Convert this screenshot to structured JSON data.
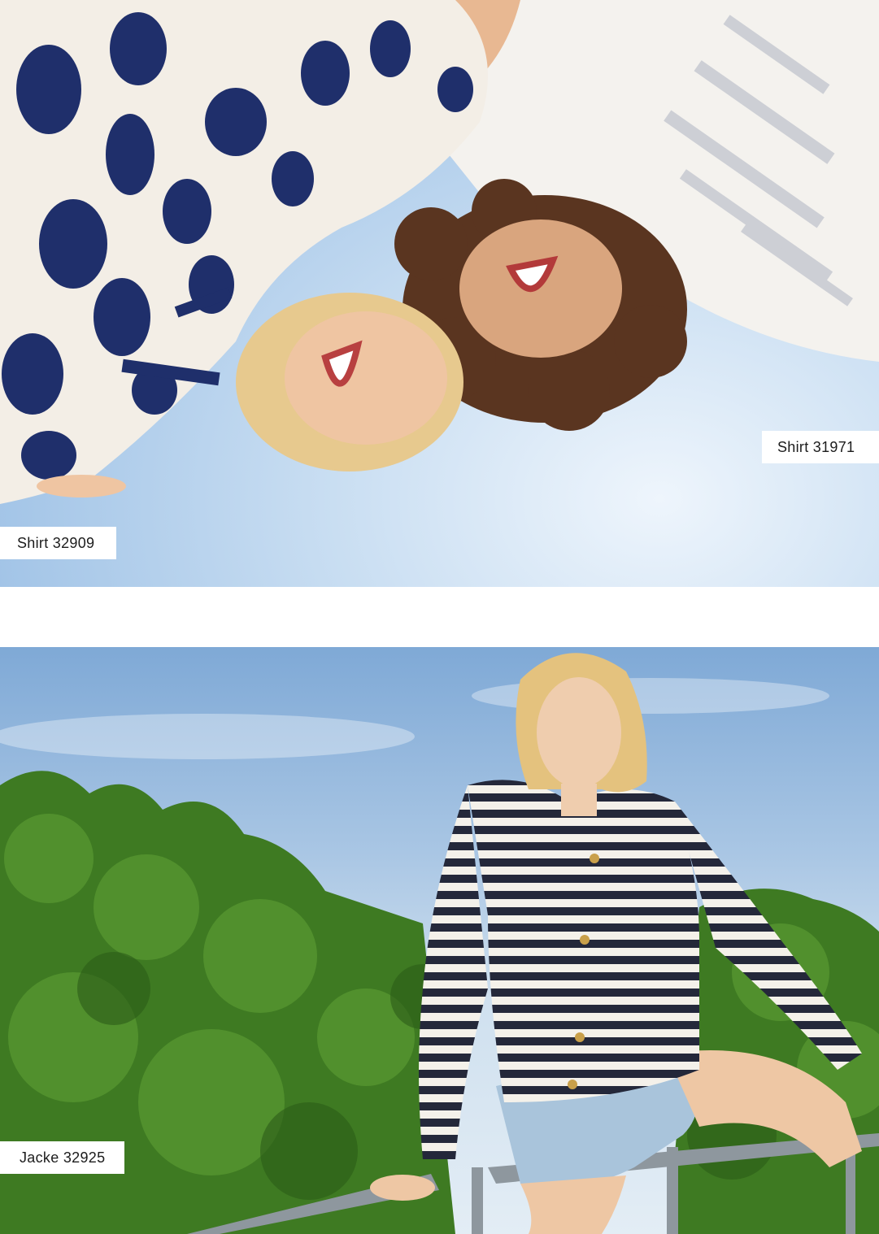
{
  "labels": {
    "shirt_31971": "Shirt 31971",
    "shirt_32909": "Shirt 32909",
    "jacke_32925": "Jacke 32925"
  },
  "colors": {
    "label_background": "#ffffff",
    "label_text": "#1c1c1c",
    "sky": "#9fc2e6",
    "print_navy": "#1f2f6b",
    "foliage": "#3e7a22"
  }
}
